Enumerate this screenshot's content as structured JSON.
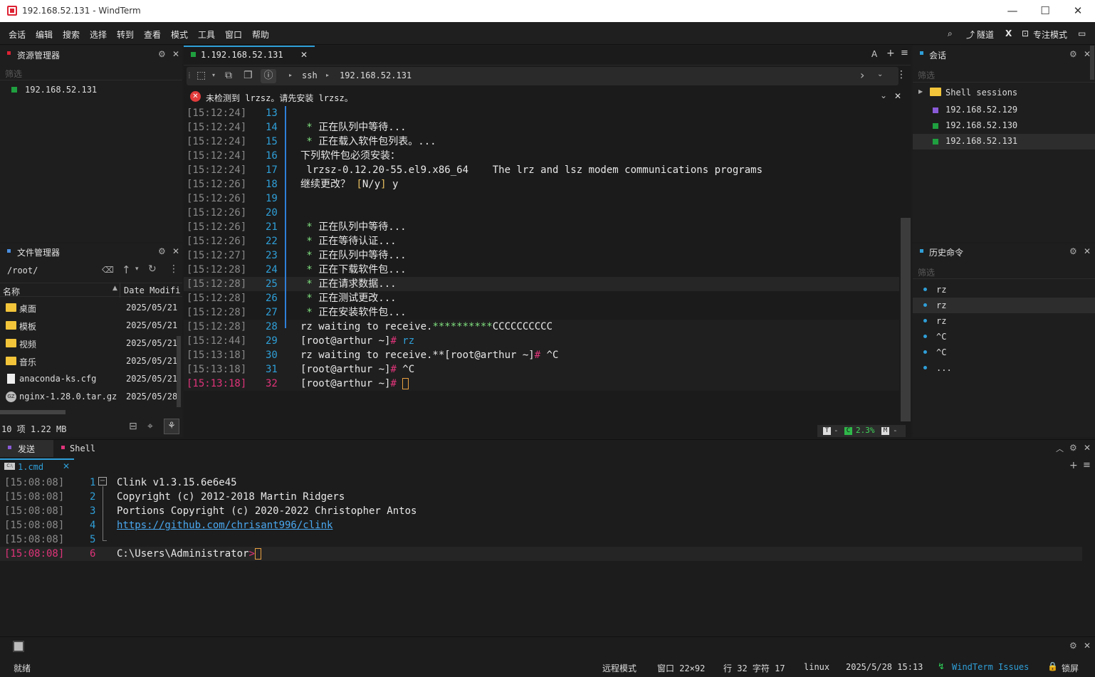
{
  "window": {
    "title": "192.168.52.131 - WindTerm"
  },
  "menu": [
    "会话",
    "编辑",
    "搜索",
    "选择",
    "转到",
    "查看",
    "模式",
    "工具",
    "窗口",
    "帮助"
  ],
  "toolbar_right": {
    "tunnel": "隧道",
    "focus_mode": "专注模式"
  },
  "explorer": {
    "title": "资源管理器",
    "filter_placeholder": "筛选",
    "items": [
      {
        "label": "192.168.52.131",
        "color": "#1f9f3f"
      }
    ]
  },
  "file_manager": {
    "title": "文件管理器",
    "path": "/root/",
    "col_name": "名称",
    "col_date": "Date Modifi",
    "files": [
      {
        "name": "桌面",
        "date": "2025/05/21",
        "type": "folder"
      },
      {
        "name": "模板",
        "date": "2025/05/21",
        "type": "folder"
      },
      {
        "name": "视频",
        "date": "2025/05/21",
        "type": "folder"
      },
      {
        "name": "音乐",
        "date": "2025/05/21",
        "type": "folder"
      },
      {
        "name": "anaconda-ks.cfg",
        "date": "2025/05/21",
        "type": "file"
      },
      {
        "name": "nginx-1.28.0.tar.gz",
        "date": "2025/05/28",
        "type": "gz"
      }
    ],
    "footer": "10 项 1.22 MB"
  },
  "main_tab": {
    "label": "1.192.168.52.131"
  },
  "tab_tools": {
    "font": "A",
    "add": "+",
    "menu": "≡"
  },
  "address": {
    "protocol": "ssh",
    "host": "192.168.52.131"
  },
  "notice": {
    "text": "未检测到 lrzsz。请先安装 lrzsz。"
  },
  "terminal_lines": [
    {
      "ts": "[15:12:24]",
      "ln": "13",
      "parts": [
        {
          "t": "",
          "c": "txt"
        }
      ]
    },
    {
      "ts": "[15:12:24]",
      "ln": "14",
      "parts": [
        {
          "t": " * ",
          "c": "grn"
        },
        {
          "t": "正在队列中等待...",
          "c": "txt"
        }
      ]
    },
    {
      "ts": "[15:12:24]",
      "ln": "15",
      "parts": [
        {
          "t": " * ",
          "c": "grn"
        },
        {
          "t": "正在载入软件包列表。...",
          "c": "txt"
        }
      ]
    },
    {
      "ts": "[15:12:24]",
      "ln": "16",
      "parts": [
        {
          "t": "下列软件包必须安装：",
          "c": "txt"
        }
      ]
    },
    {
      "ts": "[15:12:24]",
      "ln": "17",
      "parts": [
        {
          "t": " lrzsz-0.12.20-55.el9.x86_64    The lrz and lsz modem communications programs",
          "c": "txt"
        }
      ]
    },
    {
      "ts": "[15:12:26]",
      "ln": "18",
      "parts": [
        {
          "t": "继续更改？ ",
          "c": "txt"
        },
        {
          "t": "[",
          "c": "yel"
        },
        {
          "t": "N/y",
          "c": "txt"
        },
        {
          "t": "]",
          "c": "yel"
        },
        {
          "t": " y",
          "c": "txt"
        }
      ]
    },
    {
      "ts": "[15:12:26]",
      "ln": "19",
      "parts": [
        {
          "t": "",
          "c": "txt"
        }
      ]
    },
    {
      "ts": "[15:12:26]",
      "ln": "20",
      "parts": [
        {
          "t": "",
          "c": "txt"
        }
      ]
    },
    {
      "ts": "[15:12:26]",
      "ln": "21",
      "parts": [
        {
          "t": " * ",
          "c": "grn"
        },
        {
          "t": "正在队列中等待...",
          "c": "txt"
        }
      ]
    },
    {
      "ts": "[15:12:26]",
      "ln": "22",
      "parts": [
        {
          "t": " * ",
          "c": "grn"
        },
        {
          "t": "正在等待认证...",
          "c": "txt"
        }
      ]
    },
    {
      "ts": "[15:12:27]",
      "ln": "23",
      "parts": [
        {
          "t": " * ",
          "c": "grn"
        },
        {
          "t": "正在队列中等待...",
          "c": "txt"
        }
      ]
    },
    {
      "ts": "[15:12:28]",
      "ln": "24",
      "parts": [
        {
          "t": " * ",
          "c": "grn"
        },
        {
          "t": "正在下载软件包...",
          "c": "txt"
        }
      ]
    },
    {
      "ts": "[15:12:28]",
      "ln": "25",
      "parts": [
        {
          "t": " * ",
          "c": "grn"
        },
        {
          "t": "正在请求数据...",
          "c": "txt"
        }
      ]
    },
    {
      "ts": "[15:12:28]",
      "ln": "26",
      "parts": [
        {
          "t": " * ",
          "c": "grn"
        },
        {
          "t": "正在测试更改...",
          "c": "txt"
        }
      ]
    },
    {
      "ts": "[15:12:28]",
      "ln": "27",
      "parts": [
        {
          "t": " * ",
          "c": "grn"
        },
        {
          "t": "正在安装软件包...",
          "c": "txt"
        }
      ]
    },
    {
      "ts": "[15:12:28]",
      "ln": "28",
      "parts": [
        {
          "t": "rz waiting to receive.",
          "c": "txt"
        },
        {
          "t": "**********",
          "c": "grn"
        },
        {
          "t": "CCCCCCCCCC",
          "c": "txt"
        }
      ]
    },
    {
      "ts": "[15:12:44]",
      "ln": "29",
      "parts": [
        {
          "t": "[root@arthur ~]",
          "c": "txt"
        },
        {
          "t": "# ",
          "c": "red"
        },
        {
          "t": "rz",
          "c": "ln"
        }
      ]
    },
    {
      "ts": "[15:13:18]",
      "ln": "30",
      "parts": [
        {
          "t": "rz waiting to receive.**[root@arthur ~]",
          "c": "txt"
        },
        {
          "t": "# ",
          "c": "red"
        },
        {
          "t": "^C",
          "c": "txt"
        }
      ]
    },
    {
      "ts": "[15:13:18]",
      "ln": "31",
      "parts": [
        {
          "t": "[root@arthur ~]",
          "c": "txt"
        },
        {
          "t": "# ",
          "c": "red"
        },
        {
          "t": "^C",
          "c": "txt"
        }
      ]
    },
    {
      "ts": "[15:13:18]",
      "ln": "32",
      "parts": [
        {
          "t": "[root@arthur ~]",
          "c": "txt"
        },
        {
          "t": "# ",
          "c": "red"
        }
      ],
      "current": true
    }
  ],
  "term_status": {
    "t": "T",
    "c": "C",
    "cpu": "2.3%",
    "m": "M"
  },
  "sessions": {
    "title": "会话",
    "filter_placeholder": "筛选",
    "group": "Shell sessions",
    "items": [
      {
        "label": "192.168.52.129",
        "color": "#8a5bd8"
      },
      {
        "label": "192.168.52.130",
        "color": "#1f9f3f"
      },
      {
        "label": "192.168.52.131",
        "color": "#1f9f3f"
      }
    ]
  },
  "history": {
    "title": "历史命令",
    "filter_placeholder": "筛选",
    "items": [
      "rz",
      "rz",
      "rz",
      "^C",
      "^C",
      "..."
    ]
  },
  "bottom": {
    "tabs": [
      "发送",
      "Shell"
    ],
    "subtab": "1.cmd",
    "lines": [
      {
        "ts": "[15:08:08]",
        "ln": "1",
        "text": "Clink v1.3.15.6e6e45"
      },
      {
        "ts": "[15:08:08]",
        "ln": "2",
        "text": "Copyright (c) 2012-2018 Martin Ridgers"
      },
      {
        "ts": "[15:08:08]",
        "ln": "3",
        "text": "Portions Copyright (c) 2020-2022 Christopher Antos"
      },
      {
        "ts": "[15:08:08]",
        "ln": "4",
        "text": "https://github.com/chrisant996/clink",
        "link": true
      },
      {
        "ts": "[15:08:08]",
        "ln": "5",
        "text": ""
      },
      {
        "ts": "[15:08:08]",
        "ln": "6",
        "text": "C:\\Users\\Administrator",
        "prompt": ">",
        "current": true
      }
    ]
  },
  "statusbar": {
    "ready": "就绪",
    "remote_mode": "远程模式",
    "window": "窗口 22×92",
    "position": "行 32 字符 17",
    "os": "linux",
    "datetime": "2025/5/28 15:13",
    "issues": "WindTerm Issues",
    "lock": "锁屏"
  }
}
